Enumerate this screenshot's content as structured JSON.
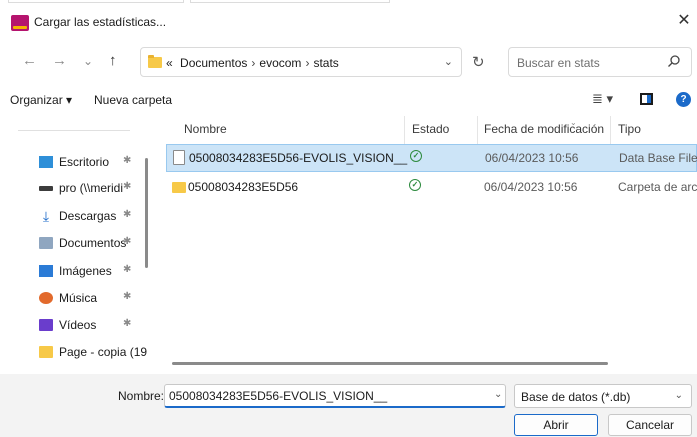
{
  "window": {
    "title": "Cargar las estadísticas...",
    "close_glyph": "✕"
  },
  "nav": {
    "back_glyph": "←",
    "forward_glyph": "→",
    "history_glyph": "⌄",
    "up_glyph": "↑",
    "breadcrumb_prefix": "«",
    "breadcrumbs": [
      "Documentos",
      "evocom",
      "stats"
    ],
    "breadcrumb_sep": "›",
    "dropdown_glyph": "⌄",
    "refresh_glyph": "↻",
    "search_placeholder": "Buscar en stats"
  },
  "toolbar": {
    "organize_label": "Organizar ▾",
    "new_folder_label": "Nueva carpeta",
    "view_glyph": "≣ ▾",
    "help_glyph": "?"
  },
  "sidebar": {
    "items": [
      {
        "label": "Escritorio",
        "icon": "desktop-icon",
        "pinned": true
      },
      {
        "label": "pro (\\\\meridi",
        "icon": "network-drive-icon",
        "pinned": true
      },
      {
        "label": "Descargas",
        "icon": "download-icon",
        "pinned": true
      },
      {
        "label": "Documentos",
        "icon": "documents-icon",
        "pinned": true
      },
      {
        "label": "Imágenes",
        "icon": "pictures-icon",
        "pinned": true
      },
      {
        "label": "Música",
        "icon": "music-icon",
        "pinned": true
      },
      {
        "label": "Vídeos",
        "icon": "videos-icon",
        "pinned": true
      },
      {
        "label": "Page - copia (19",
        "icon": "folder-icon",
        "pinned": false
      }
    ],
    "pin_glyph": "✱"
  },
  "filelist": {
    "columns": [
      "Nombre",
      "Estado",
      "Fecha de modificación",
      "Tipo"
    ],
    "rows": [
      {
        "name": "05008034283E5D56-EVOLIS_VISION__",
        "status": "ok",
        "modified": "06/04/2023 10:56",
        "type": "Data Base File",
        "icon": "file-icon",
        "selected": true
      },
      {
        "name": "05008034283E5D56",
        "status": "ok",
        "modified": "06/04/2023 10:56",
        "type": "Carpeta de archivos",
        "icon": "folder-icon",
        "selected": false
      }
    ],
    "status_glyph": "✓"
  },
  "footer": {
    "filename_label": "Nombre:",
    "filename_value": "05008034283E5D56-EVOLIS_VISION__",
    "filetype_value": "Base de datos (*.db)",
    "open_label": "Abrir",
    "cancel_label": "Cancelar"
  },
  "colors": {
    "accent": "#1b6ac9",
    "selection": "#cce4f7",
    "footer_bg": "#f3f3f3"
  }
}
